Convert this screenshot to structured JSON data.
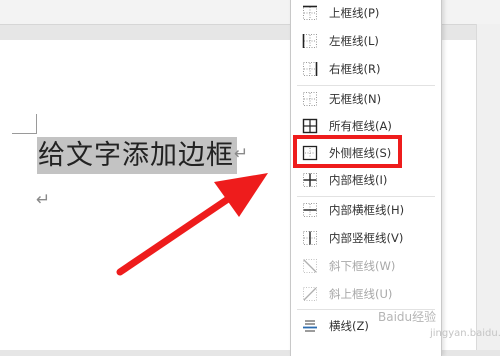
{
  "document": {
    "line1": "给文字添加边框",
    "paragraph_mark": "↵",
    "return_mark": "↵"
  },
  "menu": {
    "items": [
      {
        "label": "上框线(P)",
        "icon": "border-top-icon",
        "disabled": false
      },
      {
        "label": "左框线(L)",
        "icon": "border-left-icon",
        "disabled": false
      },
      {
        "label": "右框线(R)",
        "icon": "border-right-icon",
        "disabled": false
      },
      {
        "label": "无框线(N)",
        "icon": "no-border-icon",
        "disabled": false
      },
      {
        "label": "所有框线(A)",
        "icon": "all-borders-icon",
        "disabled": false
      },
      {
        "label": "外侧框线(S)",
        "icon": "outside-borders-icon",
        "disabled": false
      },
      {
        "label": "内部框线(I)",
        "icon": "inside-borders-icon",
        "disabled": false
      },
      {
        "label": "内部横框线(H)",
        "icon": "inside-horizontal-border-icon",
        "disabled": false
      },
      {
        "label": "内部竖框线(V)",
        "icon": "inside-vertical-border-icon",
        "disabled": false
      },
      {
        "label": "斜下框线(W)",
        "icon": "diagonal-down-border-icon",
        "disabled": true
      },
      {
        "label": "斜上框线(U)",
        "icon": "diagonal-up-border-icon",
        "disabled": true
      },
      {
        "label": "横线(Z)",
        "icon": "horizontal-line-icon",
        "disabled": false
      }
    ],
    "highlighted": "外侧框线(S)"
  },
  "watermark": {
    "text": "Baidu经验",
    "url": "jingyan.baidu.com"
  },
  "colors": {
    "highlight": "#ee1c1c",
    "arrow": "#ee1c1c",
    "selection": "#c3c3c3"
  }
}
